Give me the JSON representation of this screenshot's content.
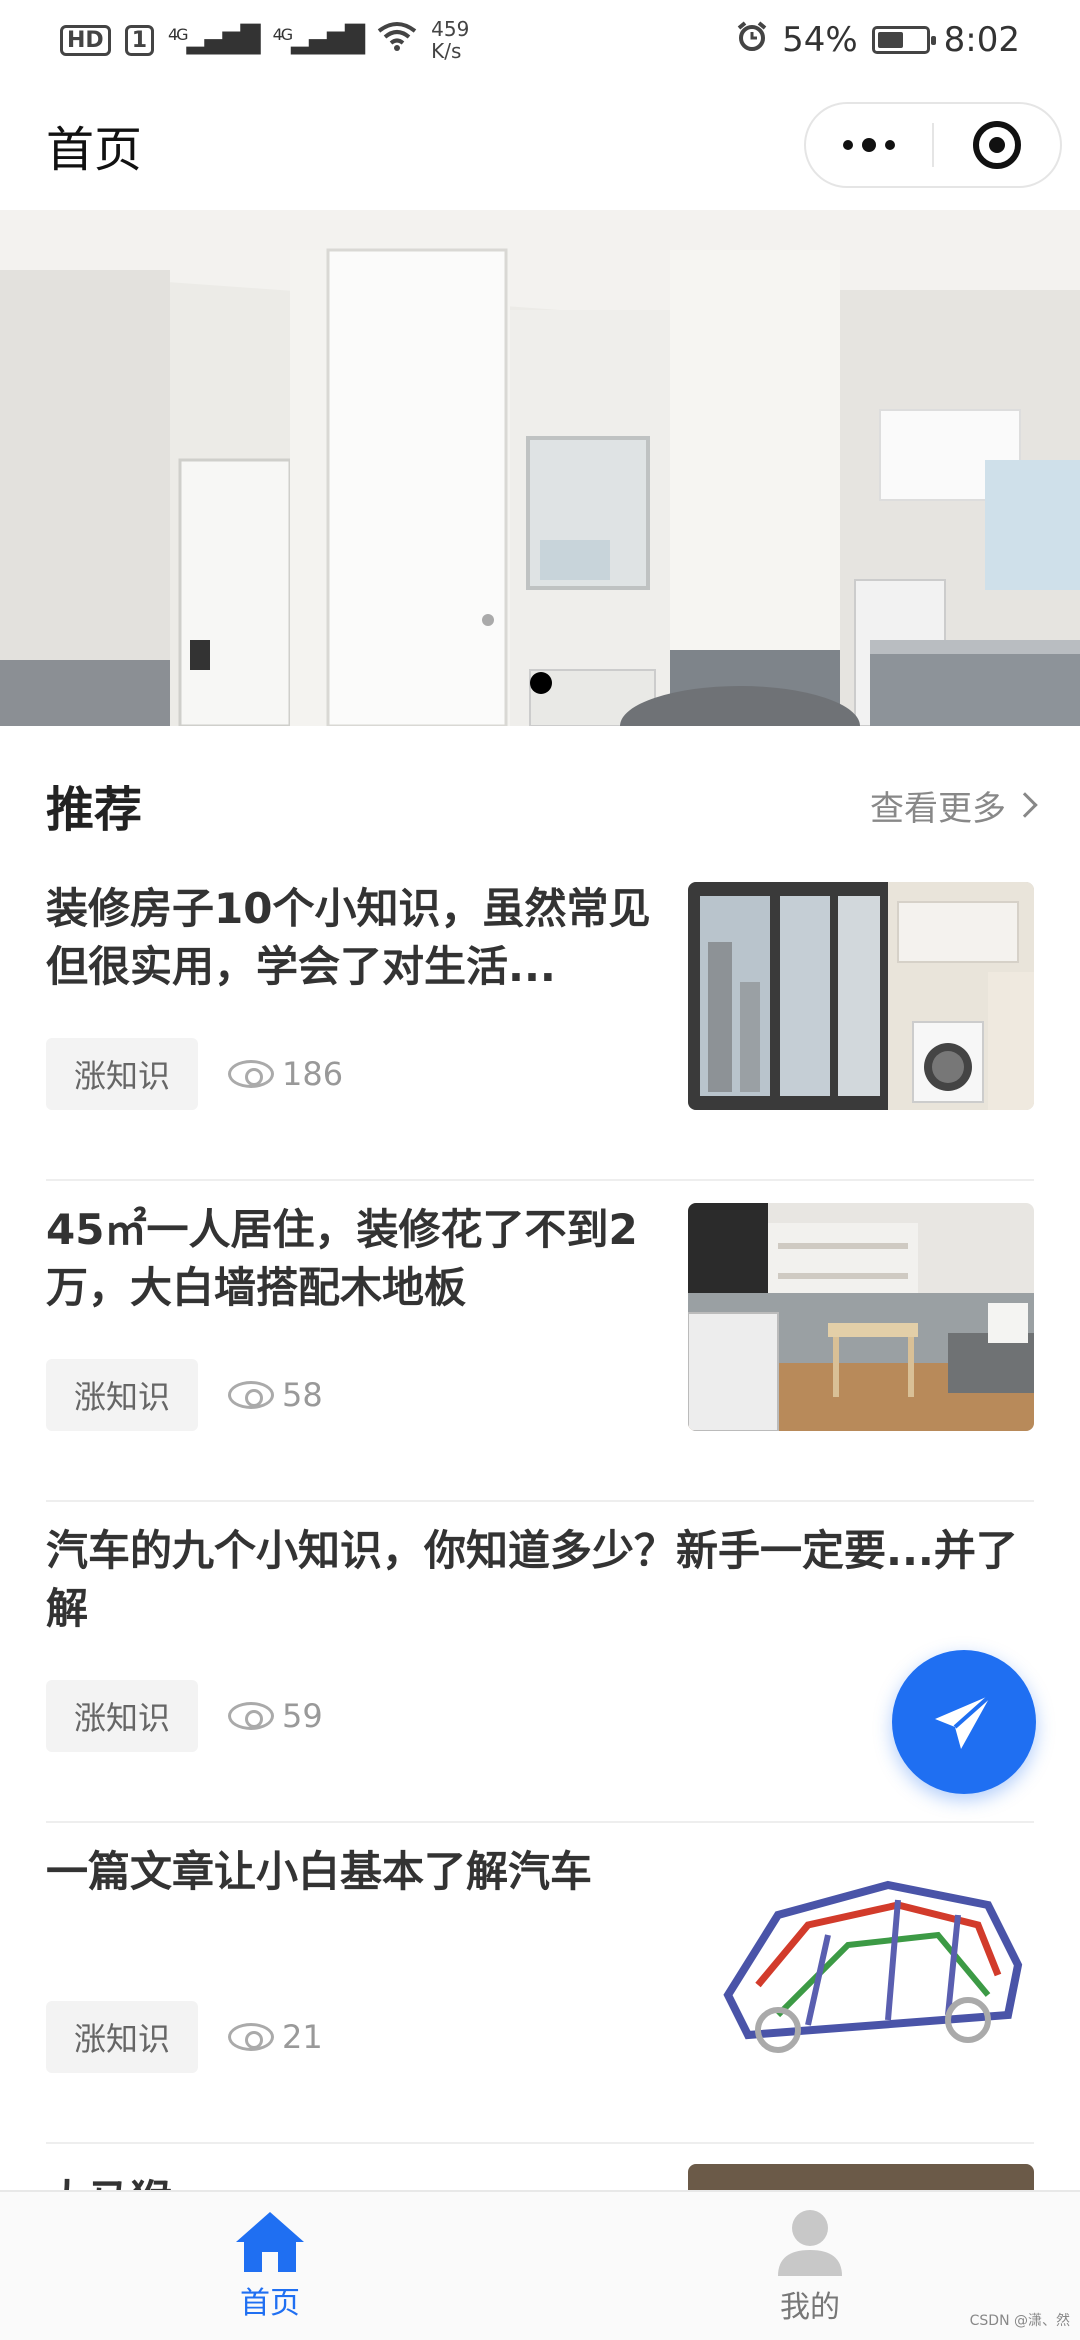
{
  "status_bar": {
    "hd": "HD",
    "sim": "1",
    "signal1": "4G",
    "signal2": "4G",
    "net_speed_value": "459",
    "net_speed_unit": "K/s",
    "battery": "54%",
    "battery_level": 0.54,
    "time": "8:02"
  },
  "nav": {
    "title": "首页"
  },
  "banner": {
    "slide_count": 1,
    "active_slide": 1
  },
  "section": {
    "title": "推荐",
    "see_more": "查看更多"
  },
  "articles": [
    {
      "title": "装修房子10个小知识，虽然常见但很实用，学会了对生活...",
      "tag": "涨知识",
      "views": "186",
      "thumb": "balcony-laundry-image"
    },
    {
      "title": "45㎡一人居住，装修花了不到2万，大白墙搭配木地板",
      "tag": "涨知识",
      "views": "58",
      "thumb": "apartment-interior-image"
    },
    {
      "title": "汽车的九个小知识，你知道多少？新手一定要...并了解",
      "tag": "涨知识",
      "views": "59",
      "thumb": ""
    },
    {
      "title": "一篇文章让小白基本了解汽车",
      "tag": "涨知识",
      "views": "21",
      "thumb": "car-frame-image"
    }
  ],
  "partial_article": {
    "title": "大马猴"
  },
  "tabs": [
    {
      "label": "首页",
      "icon": "home-icon",
      "active": true
    },
    {
      "label": "我的",
      "icon": "user-icon",
      "active": false
    }
  ],
  "watermark": "CSDN @潇、然",
  "colors": {
    "accent": "#1f6ff2",
    "text_primary": "#333333",
    "text_muted": "#999999"
  }
}
